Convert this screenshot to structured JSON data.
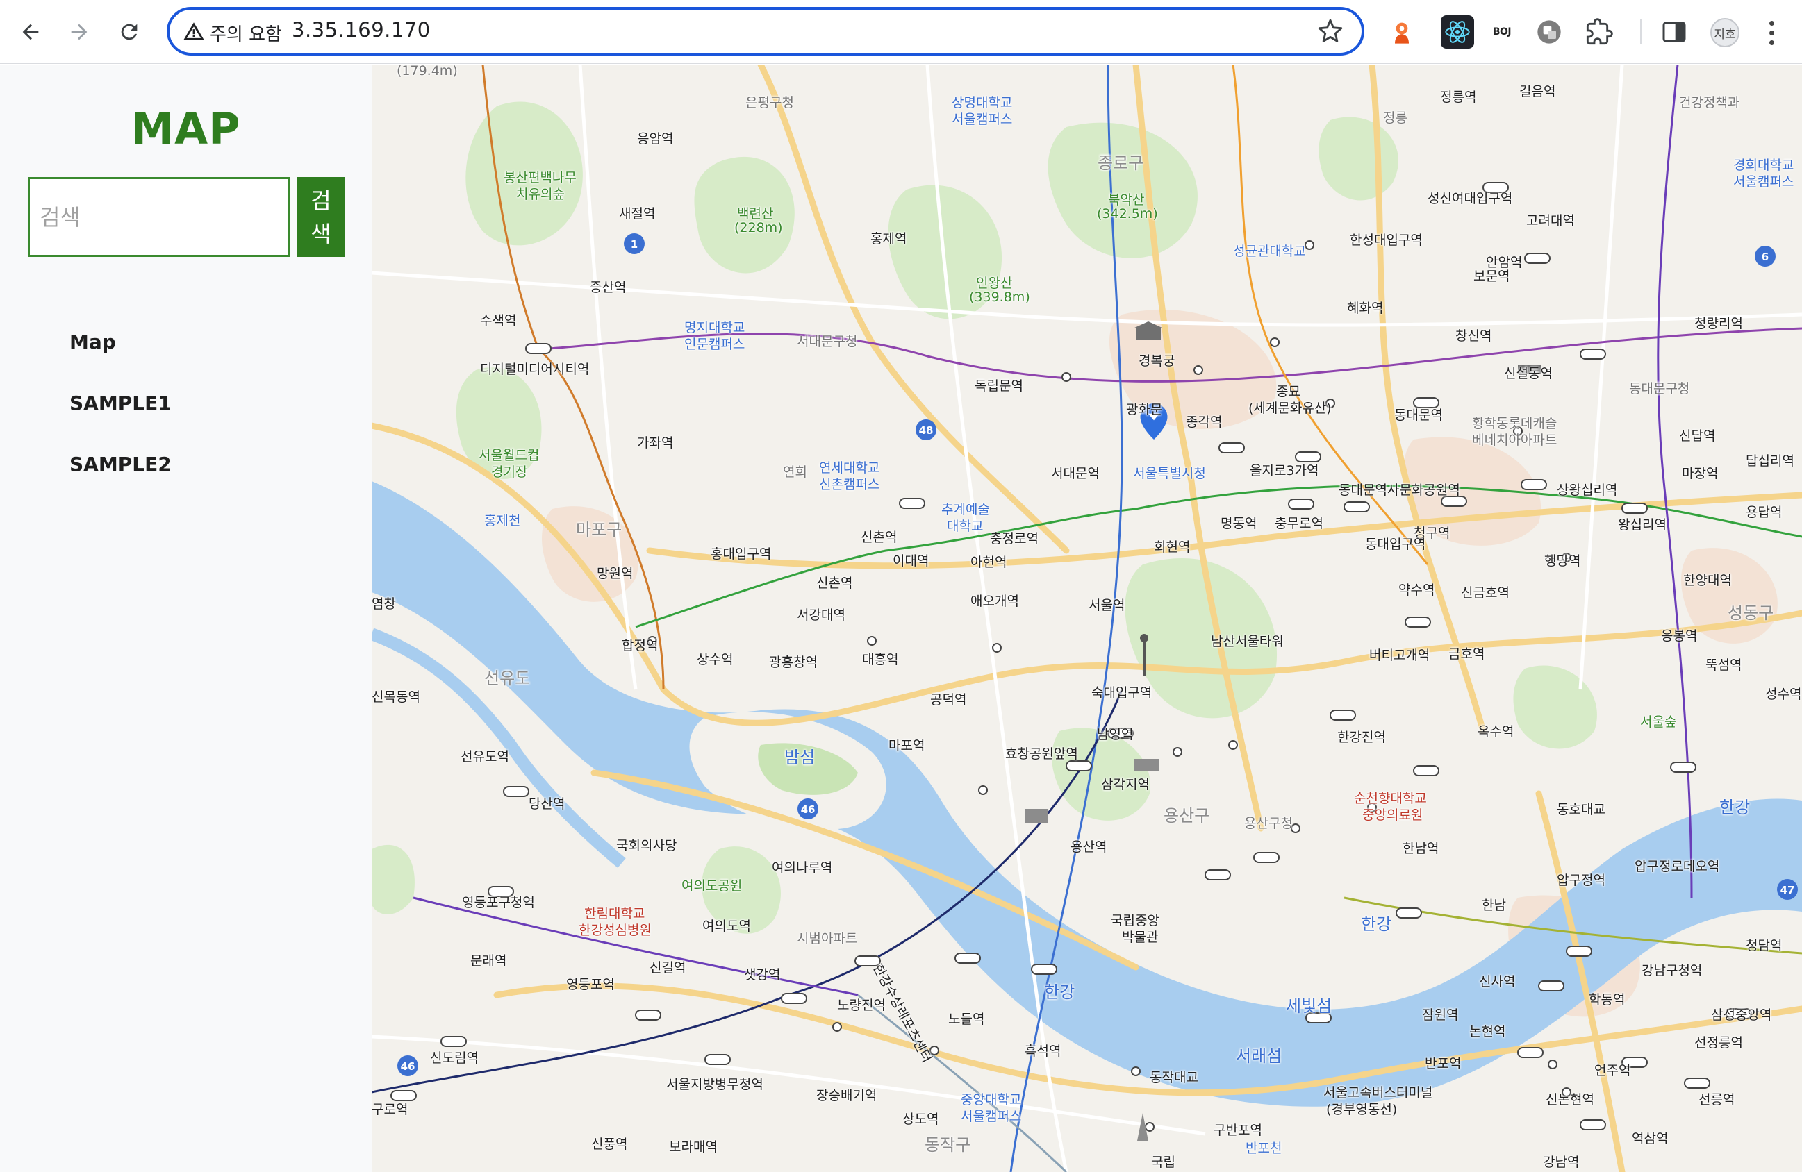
{
  "browser": {
    "security_warning": "주의 요함",
    "url": "3.35.169.170",
    "icons": {
      "back": "back-arrow-icon",
      "forward": "forward-arrow-icon",
      "reload": "reload-icon",
      "warning": "warning-triangle-icon",
      "bookmark": "star-icon",
      "extensions": "puzzle-icon",
      "side_panel": "side-panel-icon",
      "menu": "kebab-menu-icon"
    },
    "extension_boj_label": "BOJ",
    "profile_label": "지호"
  },
  "sidebar": {
    "brand": "MAP",
    "search_placeholder": "검색",
    "search_button": "검색",
    "menu": [
      {
        "label": "Map"
      },
      {
        "label": "SAMPLE1"
      },
      {
        "label": "SAMPLE2"
      }
    ]
  },
  "map": {
    "labels": [
      {
        "text": "(179.4m)"
      },
      {
        "text": "은평구청"
      },
      {
        "text": "상명대학교"
      },
      {
        "text": "서울캠퍼스"
      },
      {
        "text": "정릉역"
      },
      {
        "text": "정릉"
      },
      {
        "text": "길음역"
      },
      {
        "text": "건강정책과"
      },
      {
        "text": "응암역"
      },
      {
        "text": "종로구"
      },
      {
        "text": "경희대학교"
      },
      {
        "text": "서울캠퍼스"
      },
      {
        "text": "봉산편백나무"
      },
      {
        "text": "치유의숲"
      },
      {
        "text": "북악산"
      },
      {
        "text": "(342.5m)"
      },
      {
        "text": "성신여대입구역"
      },
      {
        "text": "새절역"
      },
      {
        "text": "백련산"
      },
      {
        "text": "(228m)"
      },
      {
        "text": "고려대역"
      },
      {
        "text": "홍제역"
      },
      {
        "text": "성균관대학교"
      },
      {
        "text": "한성대입구역"
      },
      {
        "text": "안암역"
      },
      {
        "text": "증산역"
      },
      {
        "text": "인왕산"
      },
      {
        "text": "(339.8m)"
      },
      {
        "text": "보문역"
      },
      {
        "text": "명지대학교"
      },
      {
        "text": "인문캠퍼스"
      },
      {
        "text": "서대문구청"
      },
      {
        "text": "혜화역"
      },
      {
        "text": "청량리역"
      },
      {
        "text": "수색역"
      },
      {
        "text": "창신역"
      },
      {
        "text": "경복궁"
      },
      {
        "text": "디지털미디어시티역"
      },
      {
        "text": "신설동역"
      },
      {
        "text": "독립문역"
      },
      {
        "text": "종묘"
      },
      {
        "text": "(세계문화유산)"
      },
      {
        "text": "동대문구청"
      },
      {
        "text": "광화문"
      },
      {
        "text": "종각역"
      },
      {
        "text": "동대문역"
      },
      {
        "text": "황학동롯데캐슬"
      },
      {
        "text": "베네치아아파트"
      },
      {
        "text": "가좌역"
      },
      {
        "text": "서울월드컵"
      },
      {
        "text": "경기장"
      },
      {
        "text": "연세대학교"
      },
      {
        "text": "신촌캠퍼스"
      },
      {
        "text": "신답역"
      },
      {
        "text": "연희"
      },
      {
        "text": "서대문역"
      },
      {
        "text": "서울특별시청"
      },
      {
        "text": "을지로3가역"
      },
      {
        "text": "마장역"
      },
      {
        "text": "답십리역"
      },
      {
        "text": "추계예술"
      },
      {
        "text": "대학교"
      },
      {
        "text": "동대문역사문화공원역"
      },
      {
        "text": "상왕십리역"
      },
      {
        "text": "홍제천"
      },
      {
        "text": "마포구"
      },
      {
        "text": "명동역"
      },
      {
        "text": "충무로역"
      },
      {
        "text": "왕십리역"
      },
      {
        "text": "용답역"
      },
      {
        "text": "신촌역"
      },
      {
        "text": "충정로역"
      },
      {
        "text": "청구역"
      },
      {
        "text": "회현역"
      },
      {
        "text": "동대입구역"
      },
      {
        "text": "홍대입구역"
      },
      {
        "text": "행당역"
      },
      {
        "text": "이대역"
      },
      {
        "text": "아현역"
      },
      {
        "text": "망원역"
      },
      {
        "text": "한양대역"
      },
      {
        "text": "신촌역"
      },
      {
        "text": "약수역"
      },
      {
        "text": "신금호역"
      },
      {
        "text": "애오개역"
      },
      {
        "text": "서울역"
      },
      {
        "text": "성동구"
      },
      {
        "text": "서강대역"
      },
      {
        "text": "남산서울타워"
      },
      {
        "text": "합정역"
      },
      {
        "text": "응봉역"
      },
      {
        "text": "상수역"
      },
      {
        "text": "광흥창역"
      },
      {
        "text": "대흥역"
      },
      {
        "text": "버티고개역"
      },
      {
        "text": "금호역"
      },
      {
        "text": "뚝섬역"
      },
      {
        "text": "선유도"
      },
      {
        "text": "신목동역"
      },
      {
        "text": "숙대입구역"
      },
      {
        "text": "공덕역"
      },
      {
        "text": "성수역"
      },
      {
        "text": "서울숲"
      },
      {
        "text": "옥수역"
      },
      {
        "text": "남영역"
      },
      {
        "text": "선유도역"
      },
      {
        "text": "마포역"
      },
      {
        "text": "밤섬"
      },
      {
        "text": "효창공원앞역"
      },
      {
        "text": "한강진역"
      },
      {
        "text": "당산역"
      },
      {
        "text": "삼각지역"
      },
      {
        "text": "순천향대학교"
      },
      {
        "text": "중앙의료원"
      },
      {
        "text": "동호대교"
      },
      {
        "text": "용산구"
      },
      {
        "text": "용산구청"
      },
      {
        "text": "한강"
      },
      {
        "text": "국회의사당"
      },
      {
        "text": "한남역"
      },
      {
        "text": "여의나루역"
      },
      {
        "text": "여의도공원"
      },
      {
        "text": "용산역"
      },
      {
        "text": "압구정역"
      },
      {
        "text": "압구정로데오역"
      },
      {
        "text": "영등포구청역"
      },
      {
        "text": "한림대학교"
      },
      {
        "text": "한강성심병원"
      },
      {
        "text": "국립중앙"
      },
      {
        "text": "박물관"
      },
      {
        "text": "한남"
      },
      {
        "text": "여의도역"
      },
      {
        "text": "시범아파트"
      },
      {
        "text": "한강"
      },
      {
        "text": "청담역"
      },
      {
        "text": "문래역"
      },
      {
        "text": "신길역"
      },
      {
        "text": "샛강역"
      },
      {
        "text": "한강"
      },
      {
        "text": "신사역"
      },
      {
        "text": "강남구청역"
      },
      {
        "text": "영등포역"
      },
      {
        "text": "노량진역"
      },
      {
        "text": "세빛섬"
      },
      {
        "text": "학동역"
      },
      {
        "text": "신도림역"
      },
      {
        "text": "노들역"
      },
      {
        "text": "잠원역"
      },
      {
        "text": "논현역"
      },
      {
        "text": "삼성중앙역"
      },
      {
        "text": "흑석역"
      },
      {
        "text": "서래섬"
      },
      {
        "text": "선정릉역"
      },
      {
        "text": "반포역"
      },
      {
        "text": "동작대교"
      },
      {
        "text": "언주역"
      },
      {
        "text": "구로역"
      },
      {
        "text": "서울지방병무청역"
      },
      {
        "text": "중앙대학교"
      },
      {
        "text": "서울캠퍼스"
      },
      {
        "text": "서울고속버스터미널"
      },
      {
        "text": "(경부영동선)"
      },
      {
        "text": "신논현역"
      },
      {
        "text": "선릉역"
      },
      {
        "text": "장승배기역"
      },
      {
        "text": "상도역"
      },
      {
        "text": "구반포역"
      },
      {
        "text": "신풍역"
      },
      {
        "text": "보라매역"
      },
      {
        "text": "동작구"
      },
      {
        "text": "반포천"
      },
      {
        "text": "역삼역"
      },
      {
        "text": "강남역"
      },
      {
        "text": "국립"
      },
      {
        "text": "한강수상레포츠센터"
      },
      {
        "text": "염창"
      }
    ],
    "route_badges": [
      "1",
      "6",
      "48",
      "46",
      "46",
      "47"
    ]
  }
}
